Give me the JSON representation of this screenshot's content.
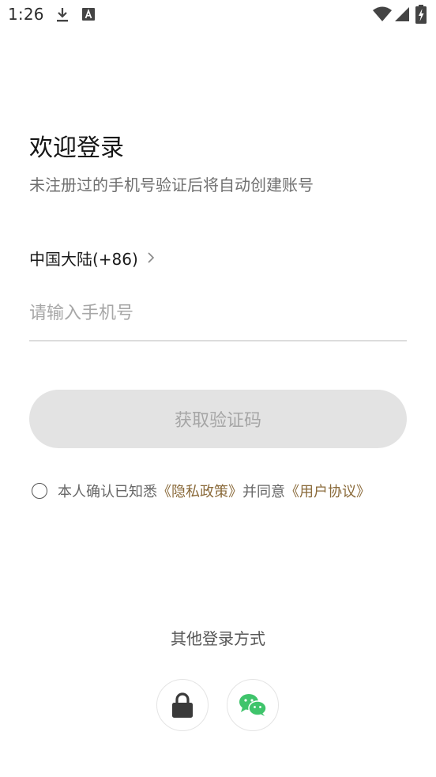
{
  "status_bar": {
    "time": "1:26",
    "icons": [
      "download-icon",
      "a-icon",
      "wifi-icon",
      "signal-icon",
      "battery-icon"
    ]
  },
  "login": {
    "title": "欢迎登录",
    "subtitle": "未注册过的手机号验证后将自动创建账号",
    "country": "中国大陆(+86)",
    "phone_placeholder": "请输入手机号",
    "phone_value": "",
    "get_code_label": "获取验证码",
    "agreement": {
      "prefix": "本人确认已知悉",
      "privacy_link": "《隐私政策》",
      "middle": "并同意",
      "terms_link": "《用户协议》",
      "checked": false
    },
    "other_login_label": "其他登录方式",
    "other_login_methods": [
      "lock-icon",
      "wechat-icon"
    ]
  },
  "colors": {
    "title": "#151515",
    "subtitle": "#6f6f6f",
    "placeholder": "#a7a7a7",
    "button_bg": "#e3e3e3",
    "button_text": "#a6a6a6",
    "link": "#8a6a3a",
    "wechat_green": "#3fc46b"
  }
}
